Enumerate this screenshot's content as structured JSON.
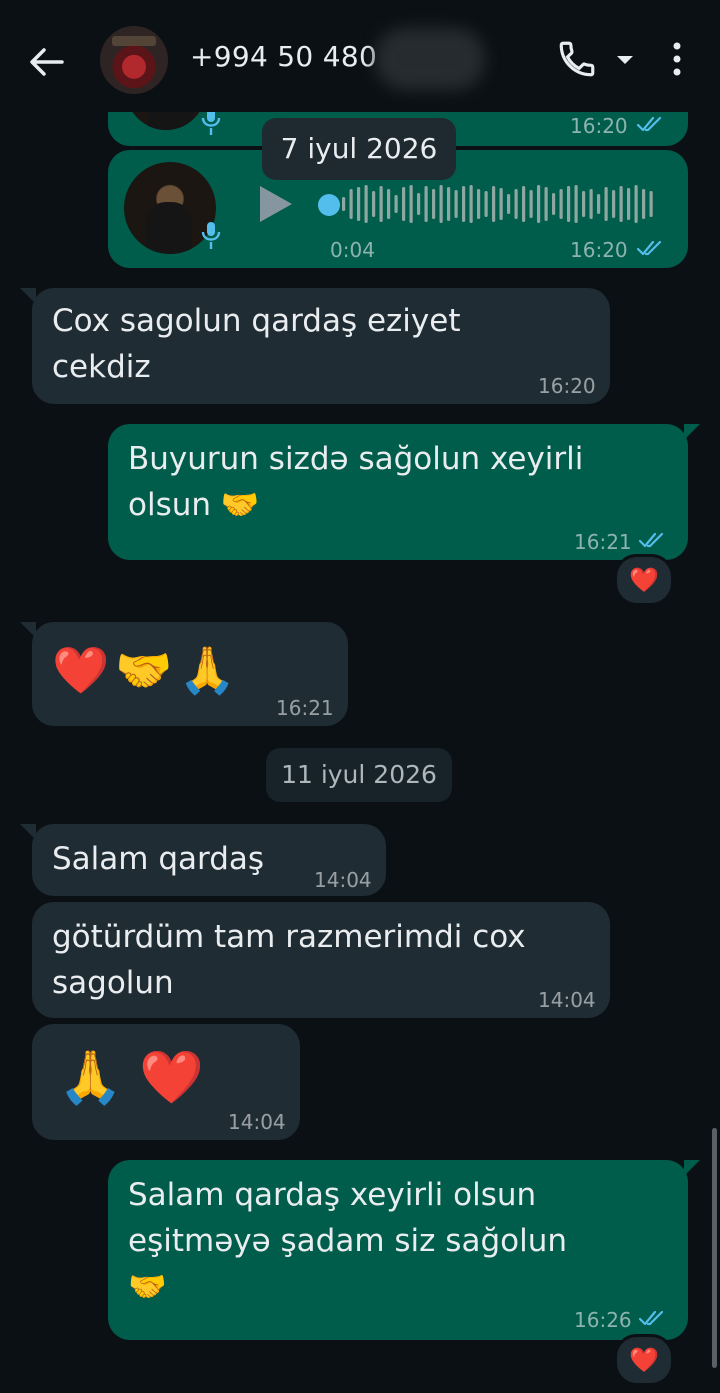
{
  "header": {
    "contact": "+994 50 480",
    "icons": [
      "back-arrow-icon",
      "avatar",
      "phone-icon",
      "caret-down-icon",
      "more-vertical-icon"
    ]
  },
  "voice_notes": [
    {
      "time": "16:20"
    },
    {
      "duration": "0:04",
      "time": "16:20"
    }
  ],
  "dates": {
    "first": "7 iyul 2026",
    "second": "11 iyul 2026"
  },
  "messages": [
    {
      "text": "Cox sagolun qardaş eziyet\ncekdiz",
      "time": "16:20"
    },
    {
      "text": "Buyurun sizdə sağolun xeyirli\nolsun 🤝",
      "time": "16:21",
      "reaction": "❤️"
    },
    {
      "text": "❤️🤝🙏",
      "time": "16:21"
    },
    {
      "text": "Salam qardaş",
      "time": "14:04"
    },
    {
      "text": "götürdüm tam razmerimdi cox\nsagolun",
      "time": "14:04"
    },
    {
      "text": "🙏 ❤️",
      "time": "14:04"
    },
    {
      "text": "Salam qardaş xeyirli olsun\neşitməyə şadam siz sağolun\n🤝",
      "time": "16:26",
      "reaction": "❤️"
    }
  ],
  "colors": {
    "background": "#0b1014",
    "incoming": "#202c33",
    "outgoing": "#005c4b",
    "read_ticks": "#53bdeb"
  }
}
